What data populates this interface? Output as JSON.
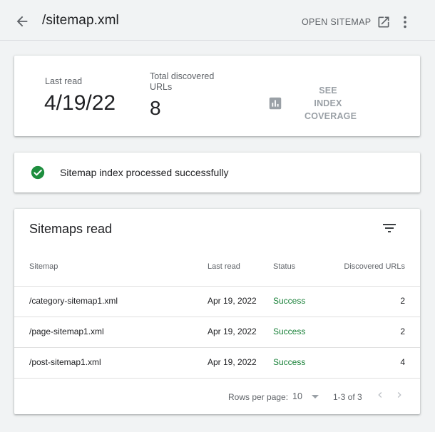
{
  "header": {
    "title": "/sitemap.xml",
    "open_sitemap_label": "OPEN SITEMAP",
    "icons": {
      "back": "arrow-back-icon",
      "open": "open-in-new-icon",
      "more": "more-vert-icon"
    }
  },
  "summary": {
    "last_read_label": "Last read",
    "last_read_value": "4/19/22",
    "discovered_label": "Total discovered URLs",
    "discovered_value": "8",
    "coverage_label": "SEE INDEX COVERAGE",
    "coverage_icon": "bar-chart-icon"
  },
  "status": {
    "message": "Sitemap index processed successfully",
    "icon": "check-circle-icon",
    "color": "#1e8e3e"
  },
  "sitemaps": {
    "title": "Sitemaps read",
    "filter_icon": "filter-icon",
    "columns": [
      "Sitemap",
      "Last read",
      "Status",
      "Discovered URLs"
    ],
    "rows": [
      {
        "sitemap": "/category-sitemap1.xml",
        "last_read": "Apr 19, 2022",
        "status": "Success",
        "discovered": "2"
      },
      {
        "sitemap": "/page-sitemap1.xml",
        "last_read": "Apr 19, 2022",
        "status": "Success",
        "discovered": "2"
      },
      {
        "sitemap": "/post-sitemap1.xml",
        "last_read": "Apr 19, 2022",
        "status": "Success",
        "discovered": "4"
      }
    ],
    "footer": {
      "rows_per_page_label": "Rows per page:",
      "rows_per_page_value": "10",
      "range": "1-3 of 3"
    },
    "status_color": "#188038"
  }
}
